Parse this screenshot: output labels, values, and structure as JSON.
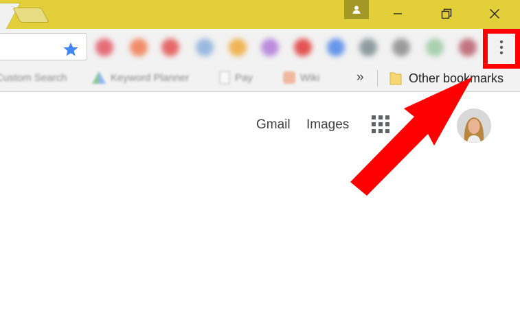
{
  "title_bar": {
    "buttons": [
      "minimize",
      "restore",
      "close"
    ],
    "icons": {
      "profile": "person-icon",
      "minimize": "minimize-icon",
      "restore": "restore-icon",
      "close": "close-icon"
    },
    "color": "#e3cf3a"
  },
  "toolbar": {
    "bookmark_star_color": "#4285f4",
    "extension_colors": [
      "#e0404f",
      "#f06a3a",
      "#e23b3b",
      "#7ea7d8",
      "#f0a020",
      "#a96ad6",
      "#e02020",
      "#3b78e8",
      "#6d7f86",
      "#7d7d7d",
      "#8fc59a",
      "#b24a5a"
    ],
    "menu_icon": "three-dots-vertical-icon"
  },
  "bookmarks_bar": {
    "items": [
      "Custom Search",
      "Keyword Planner",
      "Pay",
      "Wiki"
    ],
    "overflow_label": "»",
    "other_bookmarks": "Other bookmarks",
    "folder_color": "#f7d774"
  },
  "page": {
    "links": [
      "Gmail",
      "Images"
    ],
    "apps_icon": "apps-grid-icon",
    "avatar_icon": "profile-photo"
  },
  "annotation": {
    "highlight_color": "#ff0000",
    "arrow_color": "#ff0000"
  }
}
